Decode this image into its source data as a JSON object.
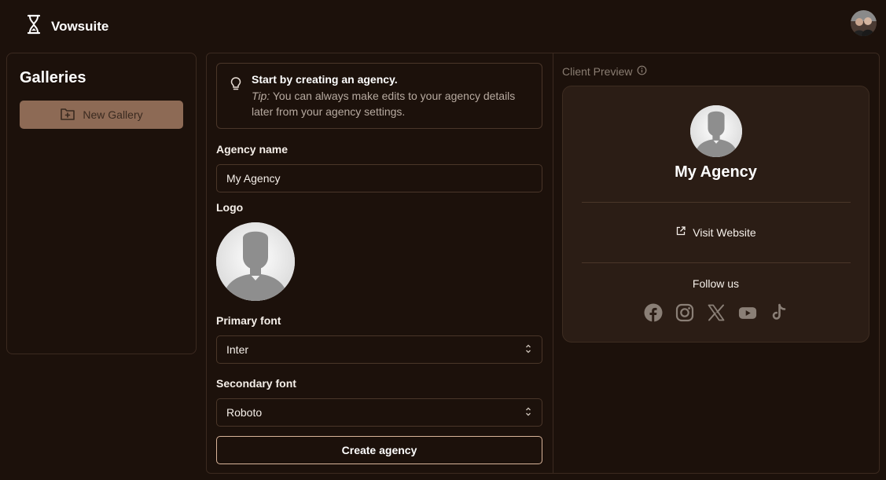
{
  "app": {
    "name": "Vowsuite"
  },
  "sidebar": {
    "title": "Galleries",
    "new_gallery_label": "New Gallery"
  },
  "form": {
    "tip": {
      "title": "Start by creating an agency.",
      "prefix": "Tip:",
      "text": "You can always make edits to your agency details later from your agency settings."
    },
    "agency_name_label": "Agency name",
    "agency_name_value": "My Agency",
    "logo_label": "Logo",
    "primary_font_label": "Primary font",
    "primary_font_value": "Inter",
    "secondary_font_label": "Secondary font",
    "secondary_font_value": "Roboto",
    "submit_label": "Create agency"
  },
  "preview": {
    "header": "Client Preview",
    "agency_name": "My Agency",
    "visit_website_label": "Visit Website",
    "follow_label": "Follow us",
    "social_icons": [
      "facebook-icon",
      "instagram-icon",
      "x-icon",
      "youtube-icon",
      "tiktok-icon"
    ]
  },
  "colors": {
    "background": "#1c110b",
    "accent": "#8d6a55",
    "card": "#2b1d15",
    "button_border": "#d9b49a"
  }
}
